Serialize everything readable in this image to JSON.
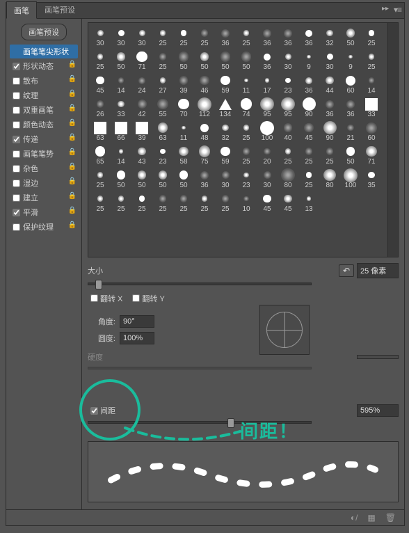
{
  "tabs": {
    "brush": "画笔",
    "preset": "画笔预设"
  },
  "sidebar": {
    "preset_button": "画笔预设",
    "items": [
      {
        "label": "画笔笔尖形状",
        "checked": null,
        "lock": false,
        "selected": true
      },
      {
        "label": "形状动态",
        "checked": true,
        "lock": true
      },
      {
        "label": "散布",
        "checked": false,
        "lock": true
      },
      {
        "label": "纹理",
        "checked": false,
        "lock": true
      },
      {
        "label": "双重画笔",
        "checked": false,
        "lock": true
      },
      {
        "label": "颜色动态",
        "checked": false,
        "lock": true
      },
      {
        "label": "传递",
        "checked": true,
        "lock": true
      },
      {
        "label": "画笔笔势",
        "checked": false,
        "lock": true
      },
      {
        "label": "杂色",
        "checked": false,
        "lock": true
      },
      {
        "label": "湿边",
        "checked": false,
        "lock": true
      },
      {
        "label": "建立",
        "checked": false,
        "lock": true
      },
      {
        "label": "平滑",
        "checked": true,
        "lock": true
      },
      {
        "label": "保护纹理",
        "checked": false,
        "lock": true
      }
    ]
  },
  "brush_sizes": [
    30,
    30,
    30,
    25,
    25,
    25,
    36,
    25,
    36,
    36,
    36,
    32,
    50,
    25,
    25,
    50,
    71,
    25,
    50,
    50,
    50,
    50,
    36,
    30,
    9,
    30,
    9,
    25,
    45,
    14,
    24,
    27,
    39,
    46,
    59,
    11,
    17,
    23,
    36,
    44,
    60,
    14,
    26,
    33,
    42,
    55,
    70,
    112,
    134,
    74,
    95,
    95,
    90,
    36,
    36,
    33,
    63,
    66,
    39,
    63,
    11,
    48,
    32,
    25,
    100,
    40,
    45,
    90,
    21,
    60,
    65,
    14,
    43,
    23,
    58,
    75,
    59,
    25,
    20,
    25,
    25,
    25,
    50,
    71,
    25,
    50,
    50,
    50,
    50,
    36,
    30,
    23,
    30,
    80,
    25,
    80,
    100,
    35,
    25,
    25,
    25,
    25,
    25,
    25,
    25,
    10,
    45,
    45,
    13
  ],
  "controls": {
    "size_label": "大小",
    "size_value": "25 像素",
    "flipx_label": "翻转 X",
    "flipy_label": "翻转 Y",
    "angle_label": "角度:",
    "angle_value": "90°",
    "roundness_label": "圆度:",
    "roundness_value": "100%",
    "hardness_label": "硬度",
    "spacing_label": "间距",
    "spacing_value": "595%"
  },
  "annotation": {
    "text": "间距！"
  }
}
